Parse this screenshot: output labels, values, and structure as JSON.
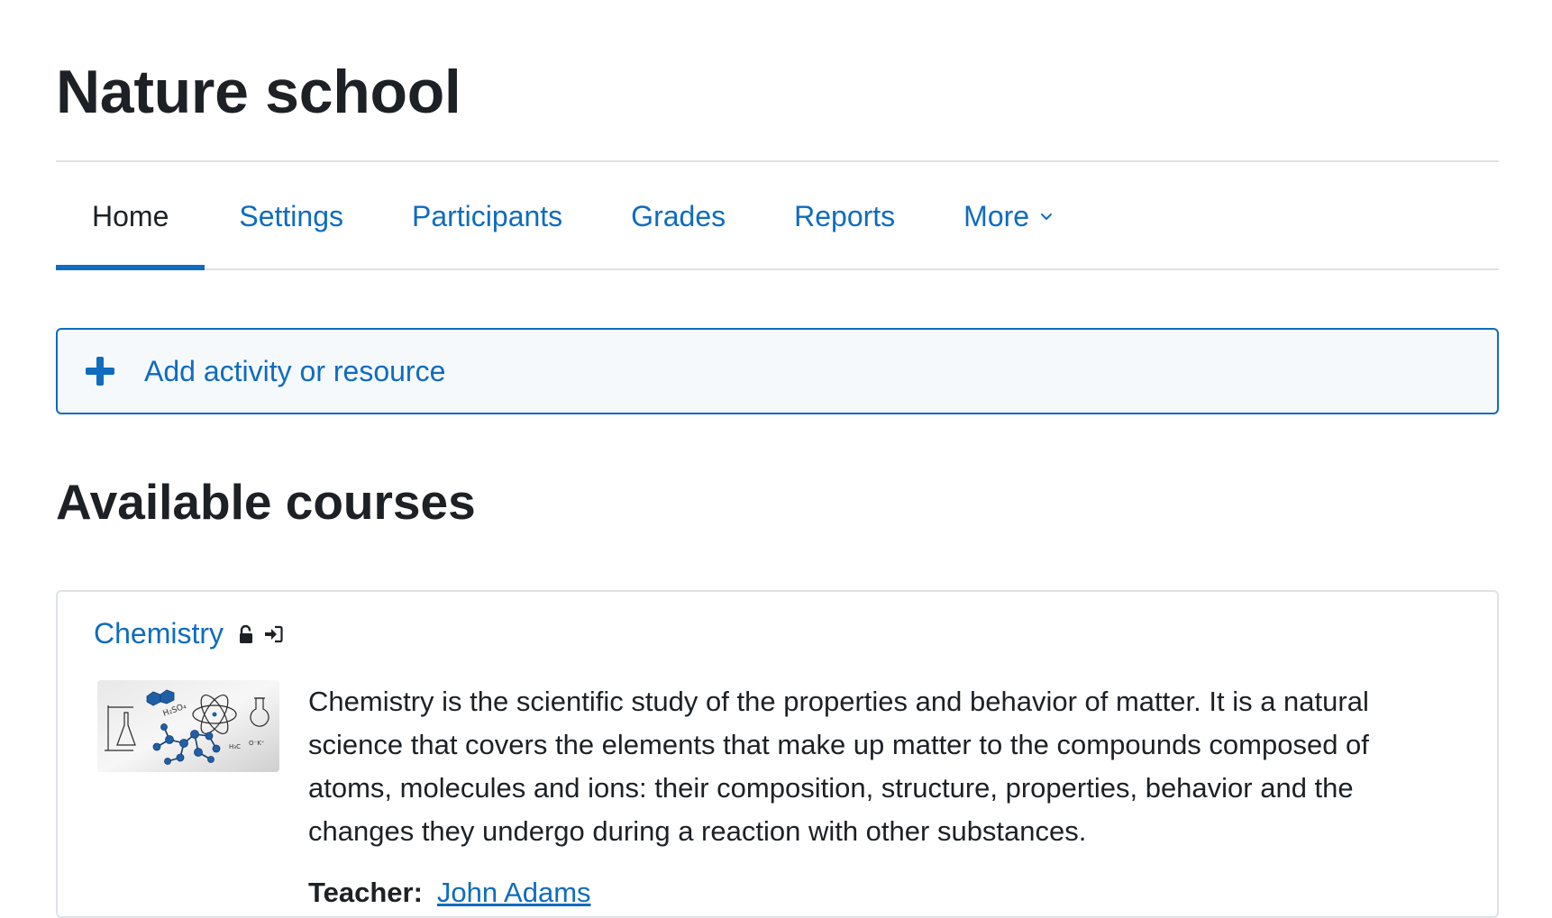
{
  "page": {
    "title": "Nature school"
  },
  "tabs": [
    {
      "label": "Home",
      "active": true
    },
    {
      "label": "Settings",
      "active": false
    },
    {
      "label": "Participants",
      "active": false
    },
    {
      "label": "Grades",
      "active": false
    },
    {
      "label": "Reports",
      "active": false
    },
    {
      "label": "More",
      "active": false
    }
  ],
  "add_activity": {
    "label": "Add activity or resource",
    "icon": "plus-icon"
  },
  "available_courses": {
    "title": "Available courses",
    "courses": [
      {
        "name": "Chemistry",
        "icons": [
          "unlock-icon",
          "sign-in-icon"
        ],
        "thumbnail": "chemistry-illustration",
        "summary": "Chemistry is the scientific study of the properties and behavior of matter. It is a natural science that covers the elements that make up matter to the compounds composed of atoms, molecules and ions: their composition, structure, properties, behavior and the changes they undergo during a reaction with other substances.",
        "teacher_label": "Teacher:",
        "teacher_name": "John Adams"
      }
    ]
  },
  "colors": {
    "link": "#0f6cbf",
    "text": "#1d2125",
    "border": "#dee2e6",
    "add_bg": "#f5f9fc"
  }
}
